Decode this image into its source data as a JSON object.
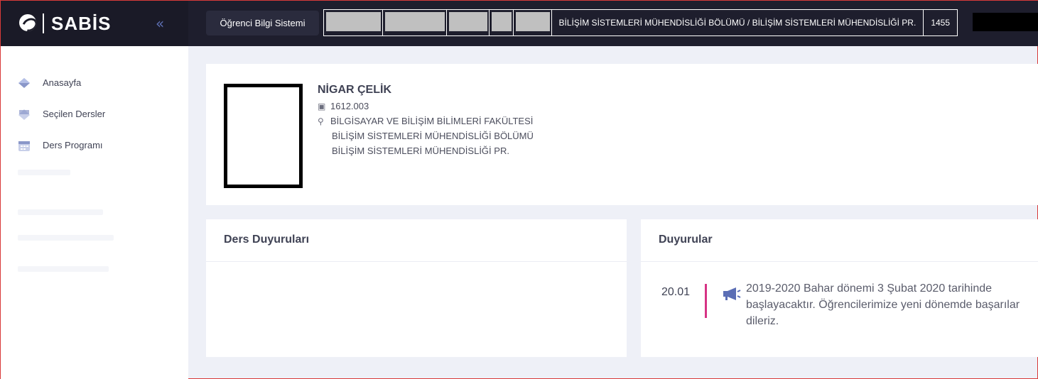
{
  "header": {
    "logo_text": "SABİS",
    "system_button": "Öğrenci Bilgi Sistemi",
    "department_path": "BİLİŞİM SİSTEMLERİ MÜHENDİSLİĞİ BÖLÜMÜ / BİLİŞİM SİSTEMLERİ MÜHENDİSLİĞİ PR.",
    "code": "1455"
  },
  "sidebar": {
    "items": [
      {
        "label": "Anasayfa",
        "icon": "home-diamond-icon"
      },
      {
        "label": "Seçilen Dersler",
        "icon": "selected-courses-icon"
      },
      {
        "label": "Ders Programı",
        "icon": "calendar-icon"
      }
    ]
  },
  "profile": {
    "name": "NİGAR ÇELİK",
    "id": "1612.003",
    "faculty": "BİLGİSAYAR VE BİLİŞİM BİLİMLERİ FAKÜLTESİ",
    "department": "BİLİŞİM SİSTEMLERİ MÜHENDİSLİĞİ BÖLÜMÜ",
    "program": "BİLİŞİM SİSTEMLERİ MÜHENDİSLİĞİ PR."
  },
  "course_announcements": {
    "title": "Ders Duyuruları"
  },
  "announcements": {
    "title": "Duyurular",
    "items": [
      {
        "date": "20.01",
        "text": "2019-2020 Bahar dönemi 3 Şubat 2020 tarihinde başlayacaktır. Öğrencilerimize yeni dönemde başarılar dileriz."
      }
    ]
  },
  "colors": {
    "topbar": "#1e1e2d",
    "accent_bar": "#d63384",
    "icon_blue": "#8a97c9"
  }
}
